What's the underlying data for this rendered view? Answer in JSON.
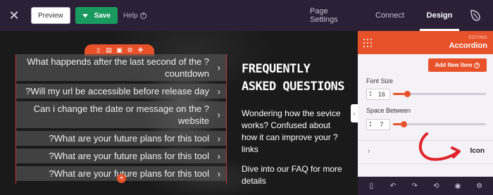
{
  "topbar": {
    "close_icon": "close-icon",
    "preview_label": "Preview",
    "save_label": "Save",
    "help_label": "Help",
    "tabs": [
      {
        "label": "Page Settings",
        "active": false
      },
      {
        "label": "Connect",
        "active": false
      },
      {
        "label": "Design",
        "active": true
      }
    ]
  },
  "canvas": {
    "toolbar_icons": [
      "mobile-icon",
      "duplicate-icon",
      "save-icon",
      "settings-icon",
      "move-icon"
    ],
    "accordion": [
      {
        "title": "What happends after the last second of the ?countdown"
      },
      {
        "title": "?Will my url be accessible before release day"
      },
      {
        "title": "Can i change the date or message on the ?website"
      },
      {
        "title": "?What are your future plans for this tool"
      },
      {
        "title": "?What are your future plans for this tool"
      },
      {
        "title": "?What are your future plans for this tool"
      }
    ],
    "faq_title": "FREQUENTLY ASKED QUESTIONS",
    "faq_description": "Wondering how the sevice works? Confused about how it can improve your ?links",
    "faq_cta": "Dive into our FAQ for more details"
  },
  "panel": {
    "editing_label": "EDITING",
    "title": "Accordion",
    "add_item_label": "Add New Item",
    "font_size_label": "Font Size",
    "font_size_value": "16",
    "font_size_fraction": 0.15,
    "space_between_label": "Space Between",
    "space_between_value": "7",
    "space_between_fraction": 0.11,
    "icon_section_label": "Icon",
    "footer_icons": [
      "mobile-icon",
      "undo-icon",
      "redo-icon",
      "history-icon",
      "eye-icon",
      "settings-icon"
    ]
  },
  "colors": {
    "accent": "#e8522a",
    "topbar": "#2b2036",
    "save_green": "#1a9a5f"
  }
}
